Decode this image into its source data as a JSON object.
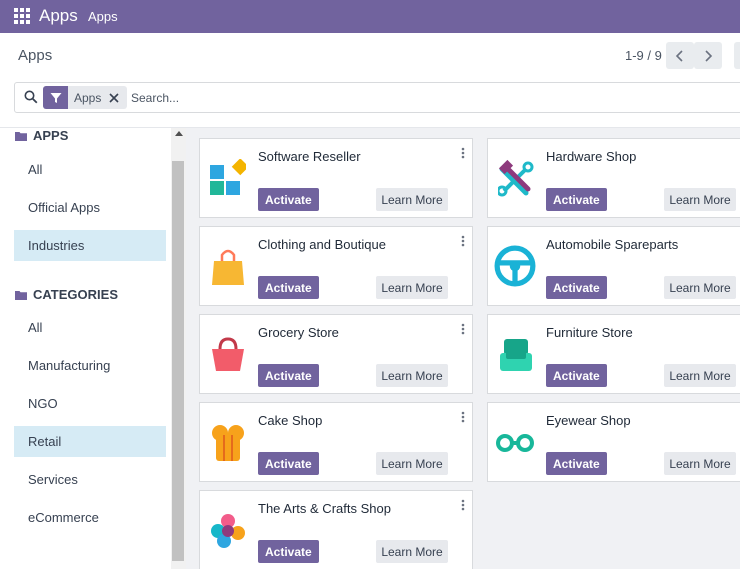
{
  "navbar": {
    "title": "Apps",
    "menu_item": "Apps"
  },
  "control_panel": {
    "breadcrumb": "Apps",
    "pager": "1-9 / 9"
  },
  "search": {
    "facet_label": "Apps",
    "placeholder": "Search..."
  },
  "sidebar": {
    "apps_header": "APPS",
    "apps_items": [
      {
        "label": "All",
        "active": false
      },
      {
        "label": "Official Apps",
        "active": false
      },
      {
        "label": "Industries",
        "active": true
      }
    ],
    "categories_header": "CATEGORIES",
    "category_items": [
      {
        "label": "All",
        "active": false
      },
      {
        "label": "Manufacturing",
        "active": false
      },
      {
        "label": "NGO",
        "active": false
      },
      {
        "label": "Retail",
        "active": true
      },
      {
        "label": "Services",
        "active": false
      },
      {
        "label": "eCommerce",
        "active": false
      }
    ]
  },
  "cards": [
    {
      "name": "Software Reseller",
      "icon": "software-reseller-icon"
    },
    {
      "name": "Hardware Shop",
      "icon": "hardware-shop-icon"
    },
    {
      "name": "Clothing and Boutique",
      "icon": "clothing-bag-icon"
    },
    {
      "name": "Automobile Spareparts",
      "icon": "steering-wheel-icon"
    },
    {
      "name": "Grocery Store",
      "icon": "grocery-basket-icon"
    },
    {
      "name": "Furniture Store",
      "icon": "armchair-icon"
    },
    {
      "name": "Cake Shop",
      "icon": "chef-hat-icon"
    },
    {
      "name": "Eyewear Shop",
      "icon": "glasses-icon"
    },
    {
      "name": "The Arts & Crafts Shop",
      "icon": "paint-palette-icon"
    }
  ],
  "buttons": {
    "activate": "Activate",
    "learn_more": "Learn More"
  },
  "colors": {
    "brand": "#71639e",
    "active_bg": "#d6ebf5"
  }
}
